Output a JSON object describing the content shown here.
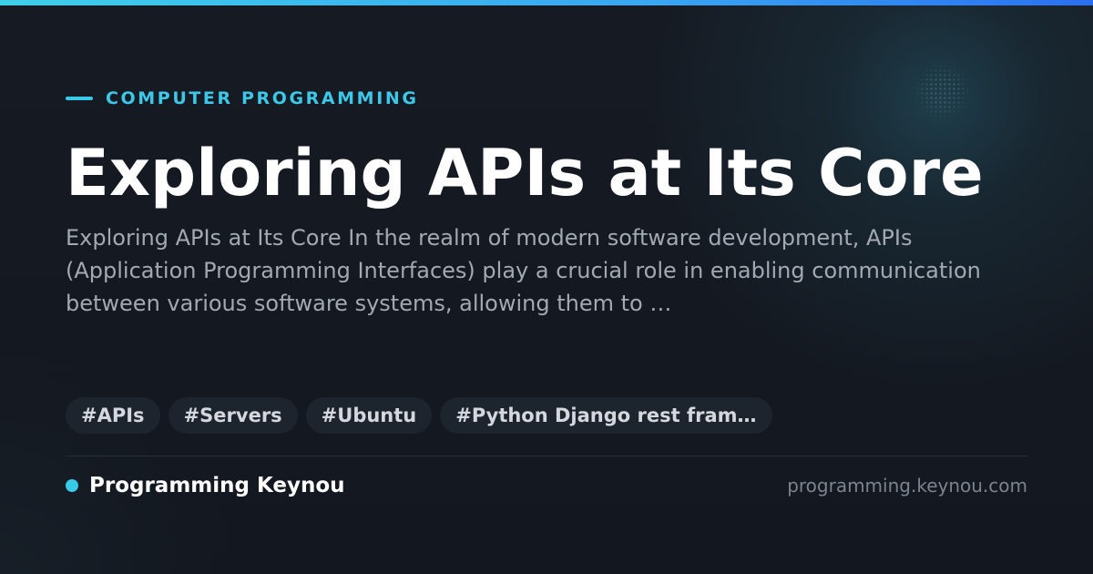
{
  "category": "COMPUTER PROGRAMMING",
  "title": "Exploring APIs at Its Core",
  "description": "Exploring APIs at Its Core In the realm of modern software development, APIs (Application Programming Interfaces) play a crucial role in enabling communication between various software systems, allowing them to …",
  "tags": [
    "#APIs",
    "#Servers",
    "#Ubuntu",
    "#Python Django rest fram…"
  ],
  "brand": {
    "name": "Programming Keynou",
    "domain": "programming.keynou.com"
  },
  "colors": {
    "accent": "#3cc8e8",
    "background": "#141821",
    "title": "#ffffff",
    "description": "#a3a9b3",
    "tag_background": "#1e242e",
    "tag_text": "#d4d8de",
    "domain": "#7d848f"
  }
}
